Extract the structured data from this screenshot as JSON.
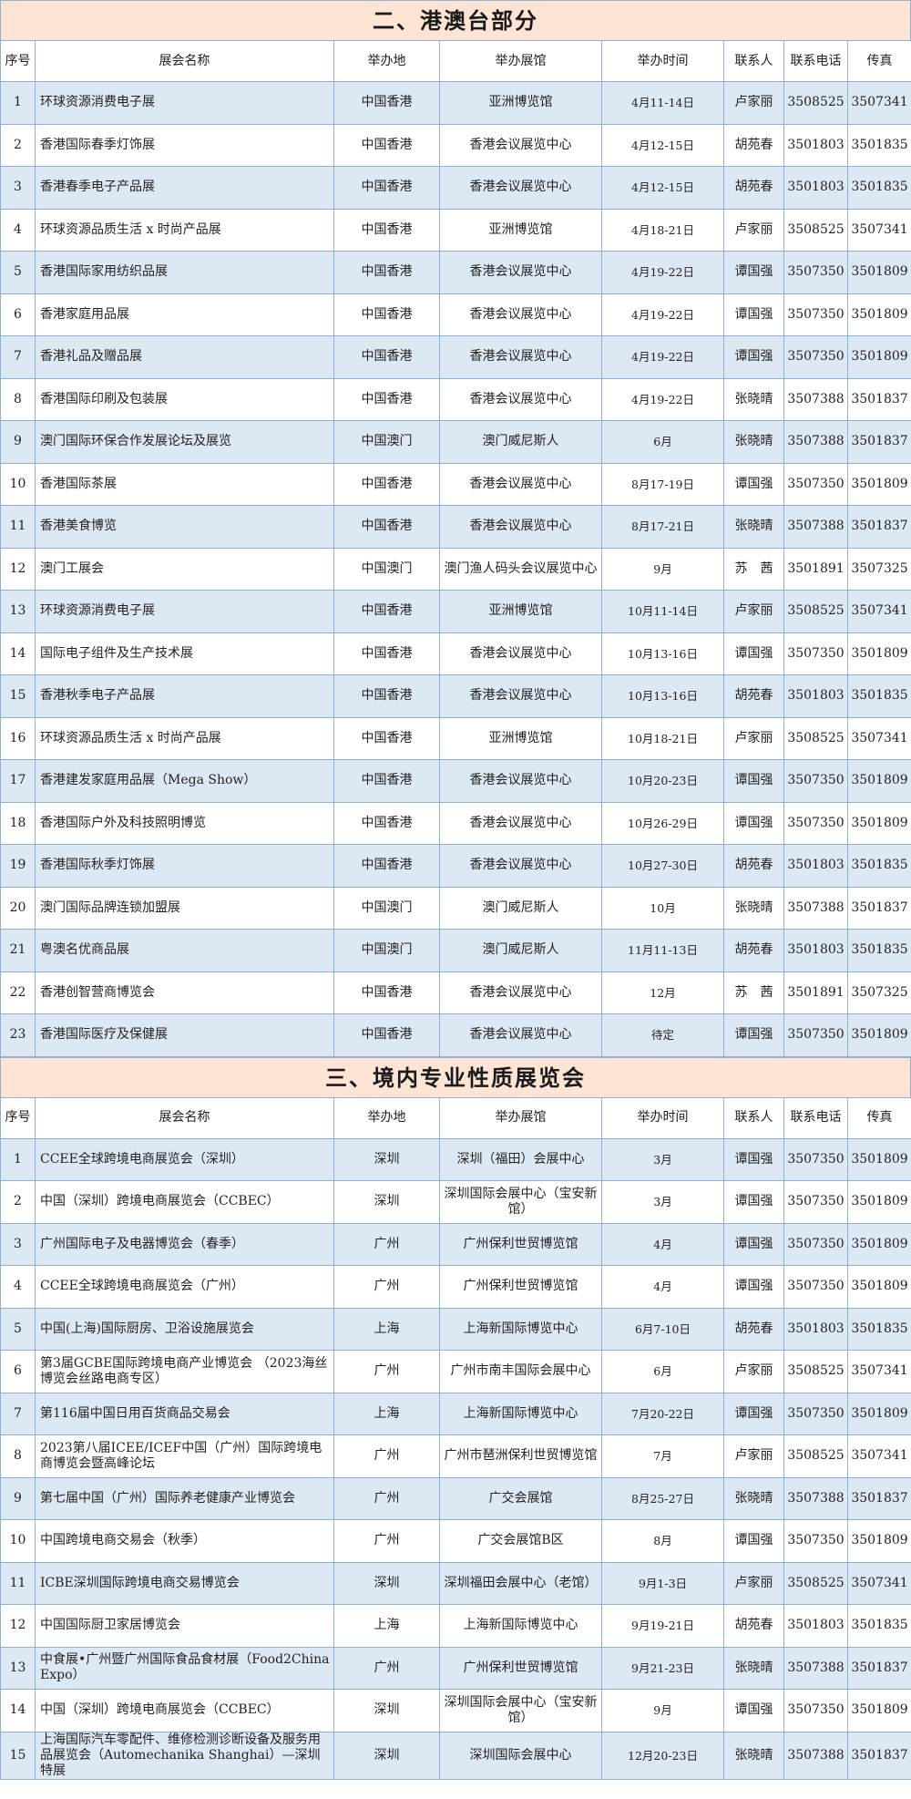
{
  "sections": [
    {
      "title": "二、港澳台部分",
      "columns": [
        "序号",
        "展会名称",
        "举办地",
        "举办展馆",
        "举办时间",
        "联系人",
        "联系电话",
        "传真"
      ],
      "rows": [
        [
          "1",
          "环球资源消费电子展",
          "中国香港",
          "亚洲博览馆",
          "4月11-14日",
          "卢家丽",
          "3508525",
          "3507341"
        ],
        [
          "2",
          "香港国际春季灯饰展",
          "中国香港",
          "香港会议展览中心",
          "4月12-15日",
          "胡苑春",
          "3501803",
          "3501835"
        ],
        [
          "3",
          "香港春季电子产品展",
          "中国香港",
          "香港会议展览中心",
          "4月12-15日",
          "胡苑春",
          "3501803",
          "3501835"
        ],
        [
          "4",
          "环球资源品质生活 x 时尚产品展",
          "中国香港",
          "亚洲博览馆",
          "4月18-21日",
          "卢家丽",
          "3508525",
          "3507341"
        ],
        [
          "5",
          "香港国际家用纺织品展",
          "中国香港",
          "香港会议展览中心",
          "4月19-22日",
          "谭国强",
          "3507350",
          "3501809"
        ],
        [
          "6",
          "香港家庭用品展",
          "中国香港",
          "香港会议展览中心",
          "4月19-22日",
          "谭国强",
          "3507350",
          "3501809"
        ],
        [
          "7",
          "香港礼品及赠品展",
          "中国香港",
          "香港会议展览中心",
          "4月19-22日",
          "谭国强",
          "3507350",
          "3501809"
        ],
        [
          "8",
          "香港国际印刷及包装展",
          "中国香港",
          "香港会议展览中心",
          "4月19-22日",
          "张晓晴",
          "3507388",
          "3501837"
        ],
        [
          "9",
          "澳门国际环保合作发展论坛及展览",
          "中国澳门",
          "澳门威尼斯人",
          "6月",
          "张晓晴",
          "3507388",
          "3501837"
        ],
        [
          "10",
          "香港国际茶展",
          "中国香港",
          "香港会议展览中心",
          "8月17-19日",
          "谭国强",
          "3507350",
          "3501809"
        ],
        [
          "11",
          "香港美食博览",
          "中国香港",
          "香港会议展览中心",
          "8月17-21日",
          "张晓晴",
          "3507388",
          "3501837"
        ],
        [
          "12",
          "澳门工展会",
          "中国澳门",
          "澳门渔人码头会议展览中心",
          "9月",
          "苏　茜",
          "3501891",
          "3507325"
        ],
        [
          "13",
          "环球资源消费电子展",
          "中国香港",
          "亚洲博览馆",
          "10月11-14日",
          "卢家丽",
          "3508525",
          "3507341"
        ],
        [
          "14",
          "国际电子组件及生产技术展",
          "中国香港",
          "香港会议展览中心",
          "10月13-16日",
          "谭国强",
          "3507350",
          "3501809"
        ],
        [
          "15",
          "香港秋季电子产品展",
          "中国香港",
          "香港会议展览中心",
          "10月13-16日",
          "胡苑春",
          "3501803",
          "3501835"
        ],
        [
          "16",
          "环球资源品质生活 x 时尚产品展",
          "中国香港",
          "亚洲博览馆",
          "10月18-21日",
          "卢家丽",
          "3508525",
          "3507341"
        ],
        [
          "17",
          "香港建发家庭用品展（Mega Show）",
          "中国香港",
          "香港会议展览中心",
          "10月20-23日",
          "谭国强",
          "3507350",
          "3501809"
        ],
        [
          "18",
          "香港国际户外及科技照明博览",
          "中国香港",
          "香港会议展览中心",
          "10月26-29日",
          "谭国强",
          "3507350",
          "3501809"
        ],
        [
          "19",
          "香港国际秋季灯饰展",
          "中国香港",
          "香港会议展览中心",
          "10月27-30日",
          "胡苑春",
          "3501803",
          "3501835"
        ],
        [
          "20",
          "澳门国际品牌连锁加盟展",
          "中国澳门",
          "澳门威尼斯人",
          "10月",
          "张晓晴",
          "3507388",
          "3501837"
        ],
        [
          "21",
          "粤澳名优商品展",
          "中国澳门",
          "澳门威尼斯人",
          "11月11-13日",
          "胡苑春",
          "3501803",
          "3501835"
        ],
        [
          "22",
          "香港创智营商博览会",
          "中国香港",
          "香港会议展览中心",
          "12月",
          "苏　茜",
          "3501891",
          "3507325"
        ],
        [
          "23",
          "香港国际医疗及保健展",
          "中国香港",
          "香港会议展览中心",
          "待定",
          "谭国强",
          "3507350",
          "3501809"
        ]
      ]
    },
    {
      "title": "三、境内专业性质展览会",
      "columns": [
        "序号",
        "展会名称",
        "举办地",
        "举办展馆",
        "举办时间",
        "联系人",
        "联系电话",
        "传真"
      ],
      "rows": [
        [
          "1",
          "CCEE全球跨境电商展览会（深圳）",
          "深圳",
          "深圳（福田）会展中心",
          "3月",
          "谭国强",
          "3507350",
          "3501809"
        ],
        [
          "2",
          "中国（深圳）跨境电商展览会（CCBEC）",
          "深圳",
          "深圳国际会展中心（宝安新馆）",
          "3月",
          "谭国强",
          "3507350",
          "3501809"
        ],
        [
          "3",
          "广州国际电子及电器博览会（春季）",
          "广州",
          "广州保利世贸博览馆",
          "4月",
          "谭国强",
          "3507350",
          "3501809"
        ],
        [
          "4",
          "CCEE全球跨境电商展览会（广州）",
          "广州",
          "广州保利世贸博览馆",
          "4月",
          "谭国强",
          "3507350",
          "3501809"
        ],
        [
          "5",
          "中国(上海)国际厨房、卫浴设施展览会",
          "上海",
          "上海新国际博览中心",
          "6月7-10日",
          "胡苑春",
          "3501803",
          "3501835"
        ],
        [
          "6",
          "第3届GCBE国际跨境电商产业博览会 （2023海丝博览会丝路电商专区）",
          "广州",
          "广州市南丰国际会展中心",
          "6月",
          "卢家丽",
          "3508525",
          "3507341"
        ],
        [
          "7",
          "第116届中国日用百货商品交易会",
          "上海",
          "上海新国际博览中心",
          "7月20-22日",
          "谭国强",
          "3507350",
          "3501809"
        ],
        [
          "8",
          "2023第八届ICEE/ICEF中国（广州）国际跨境电商博览会暨高峰论坛",
          "广州",
          "广州市琶洲保利世贸博览馆",
          "7月",
          "卢家丽",
          "3508525",
          "3507341"
        ],
        [
          "9",
          "第七届中国（广州）国际养老健康产业博览会",
          "广州",
          "广交会展馆",
          "8月25-27日",
          "张晓晴",
          "3507388",
          "3501837"
        ],
        [
          "10",
          "中国跨境电商交易会（秋季）",
          "广州",
          "广交会展馆B区",
          "8月",
          "谭国强",
          "3507350",
          "3501809"
        ],
        [
          "11",
          "ICBE深圳国际跨境电商交易博览会",
          "深圳",
          "深圳福田会展中心（老馆）",
          "9月1-3日",
          "卢家丽",
          "3508525",
          "3507341"
        ],
        [
          "12",
          "中国国际厨卫家居博览会",
          "上海",
          "上海新国际博览中心",
          "9月19-21日",
          "胡苑春",
          "3501803",
          "3501835"
        ],
        [
          "13",
          "中食展•广州暨广州国际食品食材展（Food2China Expo）",
          "广州",
          "广州保利世贸博览馆",
          "9月21-23日",
          "张晓晴",
          "3507388",
          "3501837"
        ],
        [
          "14",
          "中国（深圳）跨境电商展览会（CCBEC）",
          "深圳",
          "深圳国际会展中心（宝安新馆）",
          "9月",
          "谭国强",
          "3507350",
          "3501809"
        ],
        [
          "15",
          "上海国际汽车零配件、维修检测诊断设备及服务用品展览会（Automechanika Shanghai）—深圳特展",
          "深圳",
          "深圳国际会展中心",
          "12月20-23日",
          "张晓晴",
          "3507388",
          "3501837"
        ]
      ]
    }
  ]
}
